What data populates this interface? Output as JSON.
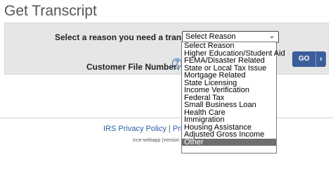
{
  "page": {
    "title": "Get Transcript"
  },
  "form": {
    "reason_label": "Select a reason you need a transcript:",
    "reason_selected": "Select Reason",
    "chevron_glyph": "⌄",
    "cfn_label": "Customer File Number:",
    "help_glyph": "?",
    "go_label": "GO",
    "go_arrow": "›"
  },
  "dropdown": {
    "options": [
      {
        "label": "Select Reason"
      },
      {
        "label": "Higher Education/Student Aid"
      },
      {
        "label": "FEMA/Disaster Related"
      },
      {
        "label": "State or Local Tax Issue"
      },
      {
        "label": "Mortgage Related"
      },
      {
        "label": "State Licensing"
      },
      {
        "label": "Income Verification"
      },
      {
        "label": "Federal Tax"
      },
      {
        "label": "Small Business Loan"
      },
      {
        "label": "Health Care"
      },
      {
        "label": "Immigration"
      },
      {
        "label": "Housing Assistance"
      },
      {
        "label": "Adjusted Gross Income"
      },
      {
        "label": "Other"
      }
    ],
    "highlighted_index": 13
  },
  "footer": {
    "privacy_link": "IRS Privacy Policy",
    "separator": " | ",
    "second_link": "Privacy",
    "version_text": "icce-webapp (version"
  },
  "colors": {
    "panel_bg": "#e6e6e6",
    "go_button": "#3b5e9a",
    "link": "#2a5ea8",
    "highlight": "#6e6e6e"
  }
}
